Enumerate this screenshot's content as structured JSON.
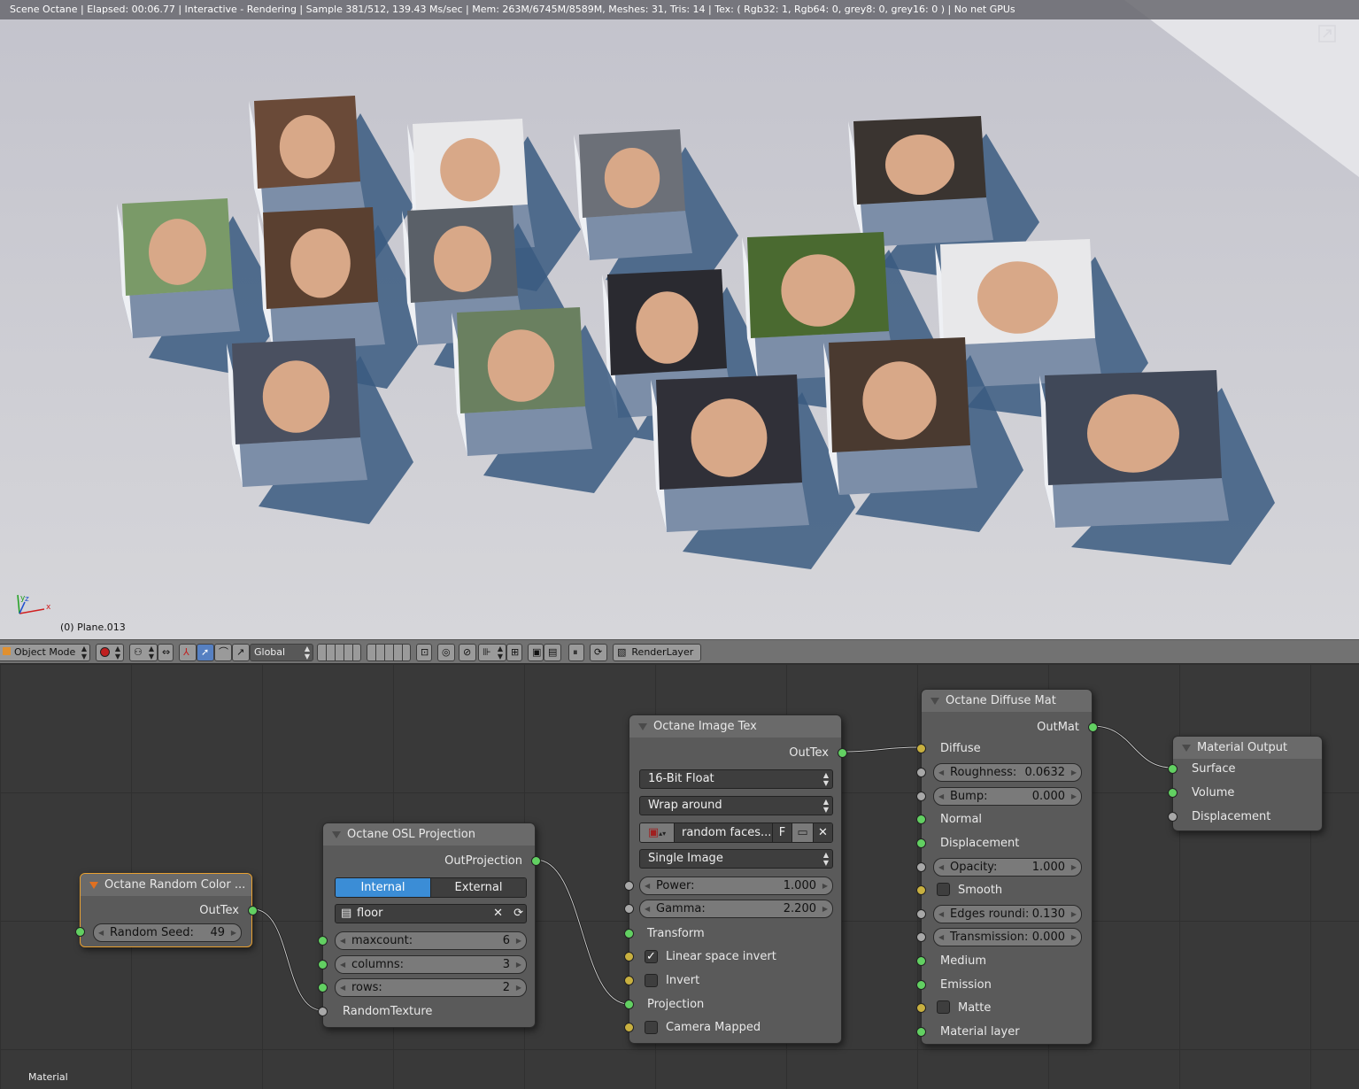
{
  "viewport": {
    "status_text": "Scene Octane | Elapsed: 00:06.77 | Interactive - Rendering | Sample 381/512, 139.43 Ms/sec | Mem: 263M/6745M/8589M, Meshes: 31, Tris: 14 | Tex: ( Rgb32: 1, Rgb64: 0, grey8: 0, grey16: 0 ) | No net GPUs",
    "object_label": "(0) Plane.013",
    "axis": {
      "x": "x",
      "y": "y",
      "z": "z"
    }
  },
  "toolbar": {
    "mode": "Object Mode",
    "orientation": "Global",
    "render_layer": "RenderLayer"
  },
  "editor": {
    "label": "Material"
  },
  "nodes": {
    "random_color": {
      "title": "Octane Random Color ...",
      "out": "OutTex",
      "seed_label": "Random Seed:",
      "seed_value": "49"
    },
    "osl_projection": {
      "title": "Octane OSL Projection",
      "out": "OutProjection",
      "tab_internal": "Internal",
      "tab_external": "External",
      "script": "floor",
      "maxcount_label": "maxcount:",
      "maxcount_value": "6",
      "columns_label": "columns:",
      "columns_value": "3",
      "rows_label": "rows:",
      "rows_value": "2",
      "in_random": "RandomTexture"
    },
    "image_tex": {
      "title": "Octane Image Tex",
      "out": "OutTex",
      "format": "16-Bit Float",
      "wrap": "Wrap around",
      "image_name": "random faces...",
      "image_flag": "F",
      "source": "Single Image",
      "power_label": "Power:",
      "power_value": "1.000",
      "gamma_label": "Gamma:",
      "gamma_value": "2.200",
      "transform": "Transform",
      "linear_label": "Linear space invert",
      "linear_checked": true,
      "invert_label": "Invert",
      "projection": "Projection",
      "camera_label": "Camera Mapped"
    },
    "diffuse_mat": {
      "title": "Octane Diffuse Mat",
      "out": "OutMat",
      "diffuse": "Diffuse",
      "roughness_label": "Roughness:",
      "roughness_value": "0.0632",
      "bump_label": "Bump:",
      "bump_value": "0.000",
      "normal": "Normal",
      "displacement": "Displacement",
      "opacity_label": "Opacity:",
      "opacity_value": "1.000",
      "smooth_label": "Smooth",
      "edges_label": "Edges roundi:",
      "edges_value": "0.130",
      "transmission_label": "Transmission:",
      "transmission_value": "0.000",
      "medium": "Medium",
      "emission": "Emission",
      "matte_label": "Matte",
      "material_layer": "Material layer"
    },
    "material_output": {
      "title": "Material Output",
      "surface": "Surface",
      "volume": "Volume",
      "displacement": "Displacement"
    }
  },
  "colors": {
    "socket_green": "#62d062",
    "socket_yellow": "#c8b040",
    "socket_grey": "#a8a8a8",
    "selected_border": "#e8a030",
    "active_tab": "#3b8dd6"
  }
}
